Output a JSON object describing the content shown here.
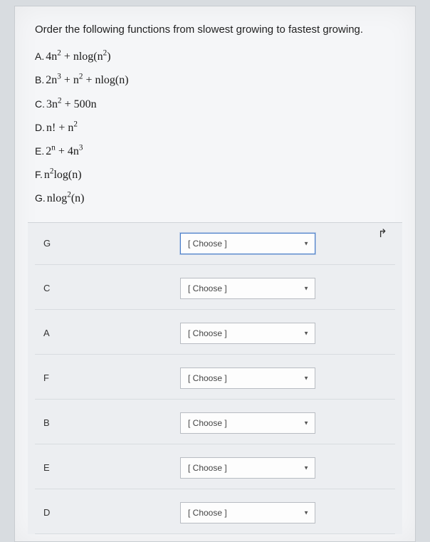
{
  "question": "Order the following functions from slowest growing to fastest growing.",
  "options": [
    {
      "label": "A.",
      "expr_html": "4n<sup>2</sup> + nlog(n<sup>2</sup>)"
    },
    {
      "label": "B.",
      "expr_html": "2n<sup>3</sup> + n<sup>2</sup> + nlog(n)"
    },
    {
      "label": "C.",
      "expr_html": "3n<sup>2</sup> + 500n"
    },
    {
      "label": "D.",
      "expr_html": "n! + n<sup>2</sup>"
    },
    {
      "label": "E.",
      "expr_html": "2<sup>n</sup> + 4n<sup>3</sup>"
    },
    {
      "label": "F.",
      "expr_html": "n<sup>2</sup>log(n)"
    },
    {
      "label": "G.",
      "expr_html": "nlog<sup>2</sup>(n)"
    }
  ],
  "answer_rows": [
    {
      "letter": "G",
      "placeholder": "[ Choose ]",
      "focused": true
    },
    {
      "letter": "C",
      "placeholder": "[ Choose ]",
      "focused": false
    },
    {
      "letter": "A",
      "placeholder": "[ Choose ]",
      "focused": false
    },
    {
      "letter": "F",
      "placeholder": "[ Choose ]",
      "focused": false
    },
    {
      "letter": "B",
      "placeholder": "[ Choose ]",
      "focused": false
    },
    {
      "letter": "E",
      "placeholder": "[ Choose ]",
      "focused": false
    },
    {
      "letter": "D",
      "placeholder": "[ Choose ]",
      "focused": false
    }
  ]
}
